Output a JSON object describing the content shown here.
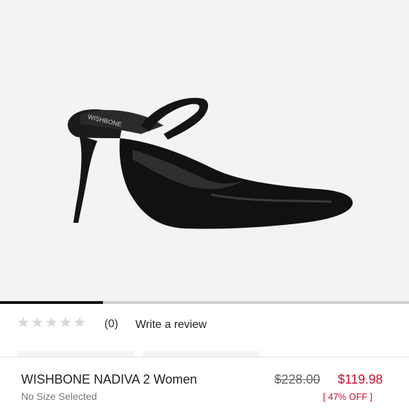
{
  "product": {
    "image_alt": "Black leather pointed-toe mule with ankle strap and stiletto heel",
    "brand_mark": "WISHBONE",
    "title": "WISHBONE NADIVA 2 Women",
    "size_status": "No Size Selected",
    "original_price": "$228.00",
    "sale_price": "$119.98",
    "discount": "[ 47% OFF ]"
  },
  "carousel": {
    "current_index": 1,
    "total": 4
  },
  "rating": {
    "stars_filled": 0,
    "stars_total": 5,
    "count": "(0)",
    "write_review_label": "Write a review"
  },
  "colors": {
    "background": "#ffffff",
    "hero_bg": "#f3f3f3",
    "star_empty": "#d9d9d9",
    "sale": "#c8102e",
    "indicator": "#111111",
    "track": "#cfcfcf"
  }
}
